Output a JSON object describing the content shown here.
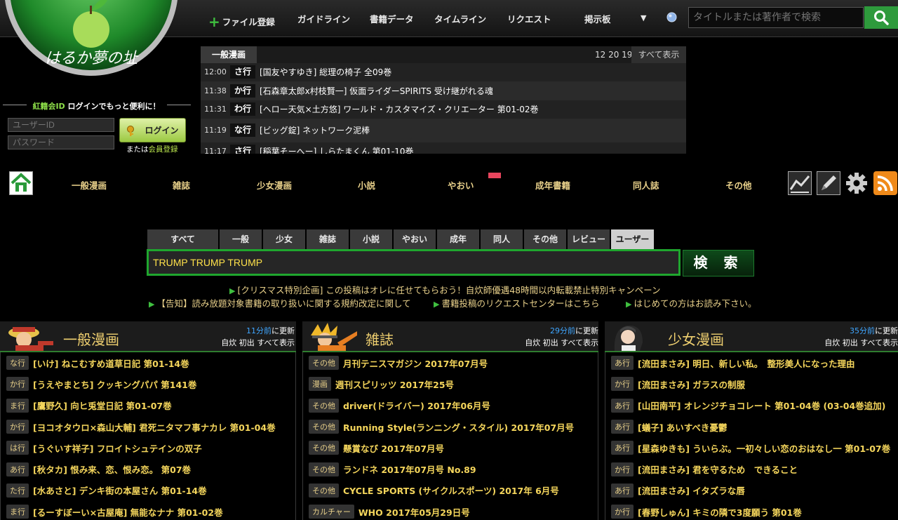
{
  "header": {
    "logo_text": "はるか夢の址",
    "nav": [
      "ファイル登録",
      "ガイドライン",
      "書籍データ",
      "タイムライン",
      "リクエスト",
      "掲示板"
    ],
    "dropdown_glyph": "▼",
    "search_placeholder": "タイトルまたは著作者で検索"
  },
  "timeline": {
    "tab": "一般漫画",
    "nums": "12 20 19",
    "all": "すべて表示",
    "rows": [
      {
        "time": "12:00",
        "kana": "さ行",
        "title": "[国友やすゆき] 総理の椅子 全09巻"
      },
      {
        "time": "11:38",
        "kana": "か行",
        "title": "[石森章太郎x村枝賢一] 仮面ライダーSPIRITS 受け継がれる魂"
      },
      {
        "time": "11:31",
        "kana": "わ行",
        "title": "[ヘロー天気×土方悠] ワールド・カスタマイズ・クリエーター 第01-02巻"
      },
      {
        "time": "11:19",
        "kana": "な行",
        "title": "[ビッグ錠] ネットワーク泥棒"
      },
      {
        "time": "11:17",
        "kana": "さ行",
        "title": "[稲葉そーへー] しらたまくん 第01-10巻"
      }
    ]
  },
  "login": {
    "title_green": "紅籍会ID",
    "title_rest": " ログインでもっと便利に！",
    "user_placeholder": "ユーザーID",
    "pass_placeholder": "パスワード",
    "button": "ログイン",
    "sub_prefix": "または",
    "sub_link": "会員登録"
  },
  "categories": [
    "一般漫画",
    "雑誌",
    "少女漫画",
    "小説",
    "やおい",
    "成年書籍",
    "同人誌",
    "その他"
  ],
  "search": {
    "tabs": [
      "すべて",
      "一般",
      "少女",
      "雑誌",
      "小説",
      "やおい",
      "成年",
      "同人",
      "その他",
      "レビュー",
      "ユーザー"
    ],
    "active_tab": "ユーザー",
    "value": "TRUMP TRUMP TRUMP",
    "button": "検 索"
  },
  "notices": {
    "line1": "[クリスマス特別企画] この投稿はオレに任せてもらおう！自炊師優遇48時間以内転載禁止特別キャンペーン",
    "line2a": "【告知】読み放題対象書籍の取り扱いに関する規約改定に関して",
    "line2b": "書籍投稿のリクエストセンターはこちら",
    "line2c": "はじめての方はお読み下さい。"
  },
  "columns": [
    {
      "title": "一般漫画",
      "update_time": "11分前",
      "update_suffix": "に更新",
      "links": "自炊 初出 すべて表示",
      "rows": [
        {
          "badge": "な行",
          "title": "[いけ] ねこむすめ道草日記 第01-14巻"
        },
        {
          "badge": "か行",
          "title": "[うえやまとち] クッキングパパ 第141巻"
        },
        {
          "badge": "ま行",
          "title": "[鷹野久] 向ヒ兎堂日記 第01-07巻"
        },
        {
          "badge": "か行",
          "title": "[ヨコオタウロ×森山大輔] 君死ニタマフ事ナカレ 第01-04巻"
        },
        {
          "badge": "は行",
          "title": "[うぐいす祥子] フロイトシュテインの双子"
        },
        {
          "badge": "あ行",
          "title": "[秋タカ] 恨み来、恋、恨み恋。 第07巻"
        },
        {
          "badge": "た行",
          "title": "[水あさと] デンキ街の本屋さん 第01-14巻"
        },
        {
          "badge": "ま行",
          "title": "[るーすぼーい×古屋庵] 無能なナナ 第01-02巻"
        }
      ]
    },
    {
      "title": "雑誌",
      "update_time": "29分前",
      "update_suffix": "に更新",
      "links": "自炊 初出 すべて表示",
      "rows": [
        {
          "badge": "その他",
          "title": "月刊テニスマガジン 2017年07月号"
        },
        {
          "badge": "漫画",
          "title": "週刊スピリッツ 2017年25号"
        },
        {
          "badge": "その他",
          "title": "driver(ドライバー) 2017年06月号"
        },
        {
          "badge": "その他",
          "title": "Running Style(ランニング・スタイル) 2017年07月号"
        },
        {
          "badge": "その他",
          "title": "懸賞なび 2017年07月号"
        },
        {
          "badge": "その他",
          "title": "ランドネ 2017年07月号 No.89"
        },
        {
          "badge": "その他",
          "title": "CYCLE SPORTS (サイクルスポーツ) 2017年 6月号"
        },
        {
          "badge": "カルチャー",
          "title": "WHO 2017年05月29日号"
        }
      ]
    },
    {
      "title": "少女漫画",
      "update_time": "35分前",
      "update_suffix": "に更新",
      "links": "自炊 初出 すべて表示",
      "rows": [
        {
          "badge": "あ行",
          "title": "[流田まさみ] 明日、新しい私。　整形美人になった理由"
        },
        {
          "badge": "か行",
          "title": "[流田まさみ] ガラスの制服"
        },
        {
          "badge": "あ行",
          "title": "[山田南平] オレンジチョコレート 第01-04巻 (03-04巻追加)"
        },
        {
          "badge": "あ行",
          "title": "[蟻子] あいすべき憂鬱"
        },
        {
          "badge": "あ行",
          "title": "[星森ゆきも] ういらぶ。一初々しい恋のおはなし一 第01-07巻"
        },
        {
          "badge": "か行",
          "title": "[流田まさみ] 君を守るため　できること"
        },
        {
          "badge": "あ行",
          "title": "[流田まさみ] イタズラな唇"
        },
        {
          "badge": "か行",
          "title": "[春野しゅん] キミの隣で3度願う 第01巻"
        }
      ]
    }
  ]
}
